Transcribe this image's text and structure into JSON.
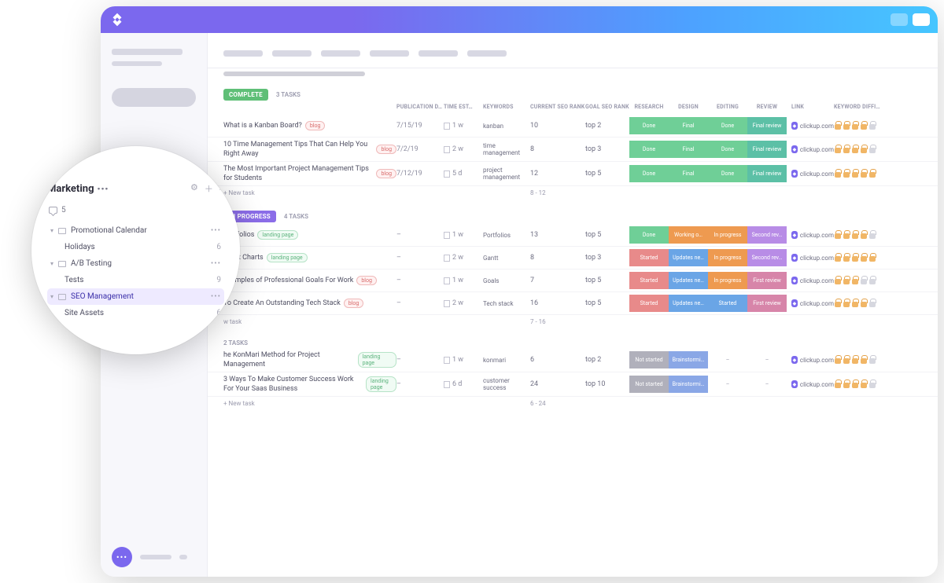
{
  "sidebar_lens": {
    "title": "Marketing",
    "comments_count": "5",
    "items": [
      {
        "label": "Promotional Calendar",
        "count": "•••",
        "folder": true,
        "chev": true
      },
      {
        "label": "Holidays",
        "count": "6",
        "indent": true
      },
      {
        "label": "A/B Testing",
        "count": "•••",
        "folder": true,
        "chev": true
      },
      {
        "label": "Tests",
        "count": "9",
        "indent": true
      },
      {
        "label": "SEO Management",
        "count": "•••",
        "folder": true,
        "chev": true,
        "active": true
      },
      {
        "label": "Site Assets",
        "count": "6",
        "indent": true
      }
    ]
  },
  "columns": {
    "publication": "PUBLICATION D…",
    "time": "TIME EST…",
    "keywords": "KEYWORDS",
    "seo": "CURRENT SEO RANK",
    "goal": "GOAL SEO RANK",
    "research": "RESEARCH",
    "design": "DESIGN",
    "editing": "EDITING",
    "review": "REVIEW",
    "link": "LINK",
    "diff": "KEYWORD DIFFI…"
  },
  "groups": [
    {
      "label": "COMPLETE",
      "color": "#5fbf77",
      "count": "3 TASKS",
      "tasks": [
        {
          "title": "What is a Kanban Board?",
          "tag": "blog",
          "pub": "7/15/19",
          "time": "1 w",
          "key": "kanban",
          "seo": "10",
          "goal": "top 2",
          "stat": [
            {
              "t": "Done",
              "c": "c-done"
            },
            {
              "t": "Final",
              "c": "c-final"
            },
            {
              "t": "Done",
              "c": "c-done"
            },
            {
              "t": "Final review",
              "c": "c-finalrev"
            }
          ],
          "link": "clickup.com",
          "diff": [
            1,
            1,
            1,
            1,
            0
          ]
        },
        {
          "title": "10 Time Management Tips That Can Help You Right Away",
          "tag": "blog",
          "pub": "7/2/19",
          "time": "2 w",
          "key": "time management",
          "seo": "8",
          "goal": "top 3",
          "stat": [
            {
              "t": "Done",
              "c": "c-done"
            },
            {
              "t": "Final",
              "c": "c-final"
            },
            {
              "t": "Done",
              "c": "c-done"
            },
            {
              "t": "Final review",
              "c": "c-finalrev"
            }
          ],
          "link": "clickup.com",
          "diff": [
            1,
            1,
            1,
            1,
            0
          ]
        },
        {
          "title": "The Most Important Project Management Tips for Students",
          "tag": "blog",
          "pub": "7/12/19",
          "time": "5 d",
          "key": "project management",
          "seo": "12",
          "goal": "top 5",
          "stat": [
            {
              "t": "Done",
              "c": "c-done"
            },
            {
              "t": "Final",
              "c": "c-final"
            },
            {
              "t": "Done",
              "c": "c-done"
            },
            {
              "t": "Final review",
              "c": "c-finalrev"
            }
          ],
          "link": "clickup.com",
          "diff": [
            1,
            1,
            1,
            1,
            1
          ]
        }
      ],
      "new": "+ New task",
      "sum": "8 - 12"
    },
    {
      "label": "IN PROGRESS",
      "color": "#8b6de8",
      "count": "4 TASKS",
      "tasks": [
        {
          "title": "Portfolios",
          "tag": "landing",
          "pub": "–",
          "time": "1 w",
          "key": "Portfolios",
          "seo": "13",
          "goal": "top 5",
          "stat": [
            {
              "t": "Done",
              "c": "c-done"
            },
            {
              "t": "Working o…",
              "c": "c-working"
            },
            {
              "t": "In progress",
              "c": "c-inprog"
            },
            {
              "t": "Second rev…",
              "c": "c-second"
            }
          ],
          "link": "clickup.com",
          "diff": [
            1,
            1,
            1,
            1,
            0
          ]
        },
        {
          "title": "Gantt Charts",
          "tag": "landing",
          "pub": "–",
          "time": "2 w",
          "key": "Gantt",
          "seo": "8",
          "goal": "top 3",
          "stat": [
            {
              "t": "Started",
              "c": "c-started"
            },
            {
              "t": "Updates ne…",
              "c": "c-updates"
            },
            {
              "t": "In progress",
              "c": "c-inprog"
            },
            {
              "t": "Second rev…",
              "c": "c-second"
            }
          ],
          "link": "clickup.com",
          "diff": [
            1,
            1,
            1,
            1,
            1
          ]
        },
        {
          "title": "Examples of Professional Goals For Work",
          "tag": "blog",
          "pub": "–",
          "time": "1 w",
          "key": "Goals",
          "seo": "7",
          "goal": "top 5",
          "stat": [
            {
              "t": "Started",
              "c": "c-started"
            },
            {
              "t": "Updates ne…",
              "c": "c-updates"
            },
            {
              "t": "In progress",
              "c": "c-inprog"
            },
            {
              "t": "First review",
              "c": "c-first"
            }
          ],
          "link": "clickup.com",
          "diff": [
            1,
            1,
            1,
            0,
            0
          ]
        },
        {
          "title": "To Create An Outstanding Tech Stack",
          "tag": "blog",
          "pub": "–",
          "time": "2 w",
          "key": "Tech stack",
          "seo": "16",
          "goal": "top 5",
          "stat": [
            {
              "t": "Started",
              "c": "c-started"
            },
            {
              "t": "Updates ne…",
              "c": "c-updates"
            },
            {
              "t": "Started",
              "c": "c-startblue"
            },
            {
              "t": "First review",
              "c": "c-first"
            }
          ],
          "link": "clickup.com",
          "diff": [
            1,
            1,
            1,
            1,
            0
          ]
        }
      ],
      "new": "w task",
      "sum": "7 - 16"
    },
    {
      "label": "",
      "color": "#c9cad3",
      "count": "2 TASKS",
      "tasks": [
        {
          "title": "he KonMari Method for Project Management",
          "tag": "landing",
          "pub": "–",
          "time": "1 w",
          "key": "konmari",
          "seo": "6",
          "goal": "top 2",
          "stat": [
            {
              "t": "Not started",
              "c": "c-notstart"
            },
            {
              "t": "Brainstormi…",
              "c": "c-brain"
            },
            {
              "t": "–",
              "c": "c-none"
            },
            {
              "t": "–",
              "c": "c-none"
            }
          ],
          "link": "clickup.com",
          "diff": [
            1,
            1,
            1,
            1,
            0
          ]
        },
        {
          "title": "3 Ways To Make Customer Success Work For Your Saas Business",
          "tag": "landing",
          "pub": "–",
          "time": "6 d",
          "key": "customer success",
          "seo": "24",
          "goal": "top 10",
          "stat": [
            {
              "t": "Not started",
              "c": "c-notstart"
            },
            {
              "t": "Brainstormi…",
              "c": "c-brain"
            },
            {
              "t": "–",
              "c": "c-none"
            },
            {
              "t": "–",
              "c": "c-none"
            }
          ],
          "link": "clickup.com",
          "diff": [
            1,
            1,
            1,
            1,
            0
          ]
        }
      ],
      "new": "+ New task",
      "sum": "6 - 24"
    }
  ]
}
